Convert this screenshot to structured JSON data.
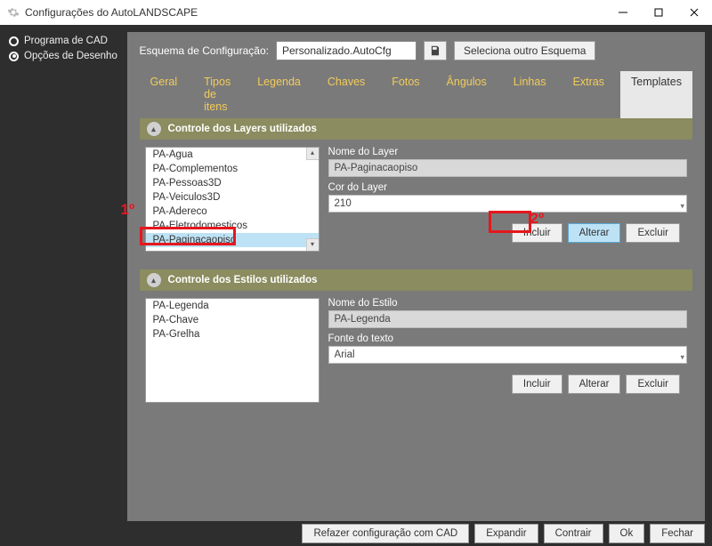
{
  "window": {
    "title": "Configurações do AutoLANDSCAPE"
  },
  "sidebar": {
    "radios": [
      {
        "label": "Programa de CAD",
        "checked": false
      },
      {
        "label": "Opções de Desenho",
        "checked": true
      }
    ]
  },
  "scheme": {
    "label": "Esquema de Configuração:",
    "value": "Personalizado.AutoCfg",
    "select_other": "Seleciona outro Esquema"
  },
  "tabs": [
    {
      "label": "Geral"
    },
    {
      "label": "Tipos de itens"
    },
    {
      "label": "Legenda"
    },
    {
      "label": "Chaves"
    },
    {
      "label": "Fotos"
    },
    {
      "label": "Ângulos"
    },
    {
      "label": "Linhas"
    },
    {
      "label": "Extras"
    },
    {
      "label": "Templates",
      "active": true
    }
  ],
  "layers": {
    "header": "Controle dos Layers utilizados",
    "list": [
      "PA-Agua",
      "PA-Complementos",
      "PA-Pessoas3D",
      "PA-Veiculos3D",
      "PA-Adereco",
      "PA-Eletrodomesticos",
      "PA-Paginacaopiso"
    ],
    "selected_index": 6,
    "name_label": "Nome do Layer",
    "name_value": "PA-Paginacaopiso",
    "color_label": "Cor do Layer",
    "color_value": "210",
    "btn_incluir": "Incluir",
    "btn_alterar": "Alterar",
    "btn_excluir": "Excluir"
  },
  "styles": {
    "header": "Controle dos Estilos utilizados",
    "list": [
      "PA-Legenda",
      "PA-Chave",
      "PA-Grelha"
    ],
    "name_label": "Nome do Estilo",
    "name_value": "PA-Legenda",
    "font_label": "Fonte do texto",
    "font_value": "Arial",
    "btn_incluir": "Incluir",
    "btn_alterar": "Alterar",
    "btn_excluir": "Excluir"
  },
  "bottom": {
    "refazer": "Refazer configuração com CAD",
    "expandir": "Expandir",
    "contrair": "Contrair",
    "ok": "Ok",
    "fechar": "Fechar"
  },
  "annotations": {
    "mark1": "1º",
    "mark2": "2º"
  }
}
